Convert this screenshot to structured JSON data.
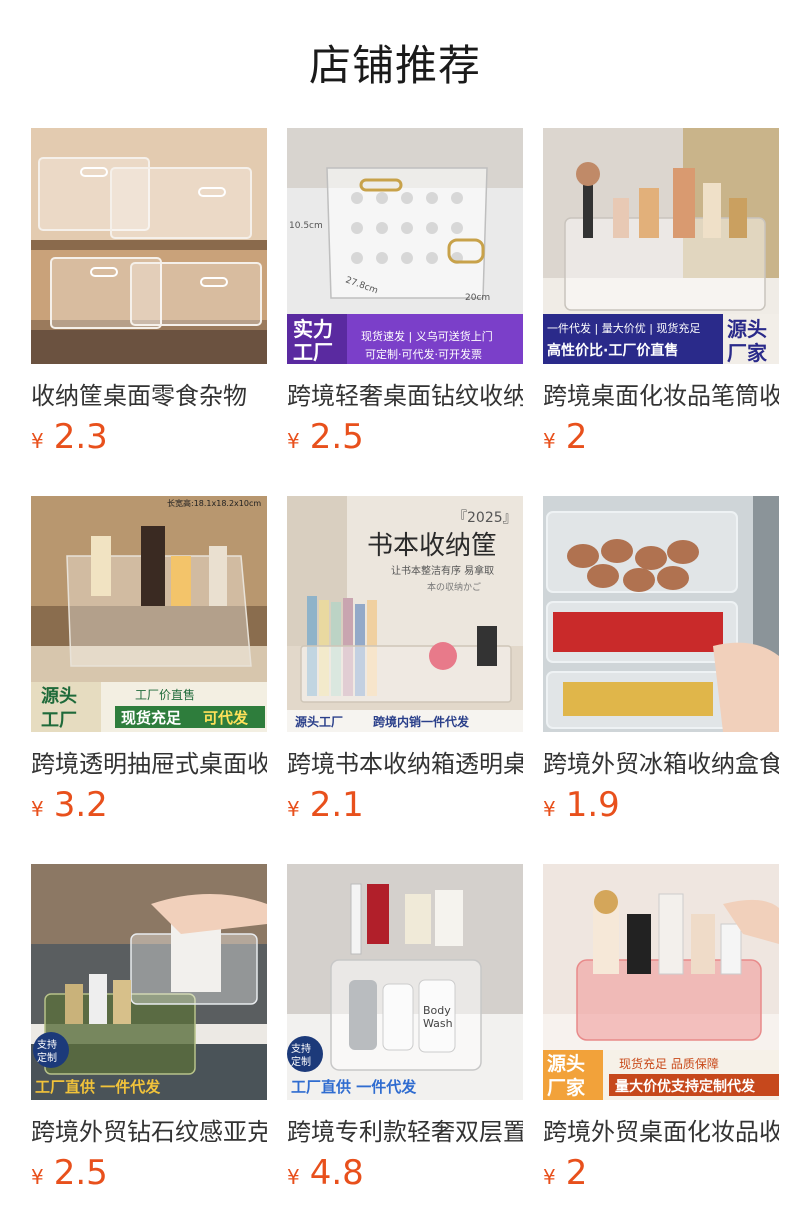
{
  "page": {
    "title": "店铺推荐"
  },
  "products": [
    {
      "name": "收纳筐桌面零食杂物",
      "currency": "¥",
      "price": "2.3",
      "image_text": []
    },
    {
      "name": "跨境轻奢桌面钻纹收纳",
      "currency": "¥",
      "price": "2.5",
      "image_text": [
        "10.5cm",
        "27.8cm",
        "20cm",
        "实力",
        "工厂",
        "现货速发 | 义乌可送货上门",
        "可定制·可代发·可开发票"
      ]
    },
    {
      "name": "跨境桌面化妆品笔筒收",
      "currency": "¥",
      "price": "2",
      "image_text": [
        "一件代发 | 量大价优 | 现货充足",
        "源头",
        "厂家",
        "高性价比·工厂价直售"
      ]
    },
    {
      "name": "跨境透明抽屉式桌面收",
      "currency": "¥",
      "price": "3.2",
      "image_text": [
        "长宽高:18.1x18.2x10cm",
        "源头",
        "工厂",
        "工厂价直售",
        "现货充足",
        "可代发"
      ]
    },
    {
      "name": "跨境书本收纳箱透明桌",
      "currency": "¥",
      "price": "2.1",
      "image_text": [
        "『2025』",
        "书本收纳筐",
        "让书本整洁有序 易拿取",
        "本の収纳かご",
        "源头工厂",
        "跨境内销一件代发"
      ]
    },
    {
      "name": "跨境外贸冰箱收纳盒食",
      "currency": "¥",
      "price": "1.9",
      "image_text": []
    },
    {
      "name": "跨境外贸钻石纹感亚克",
      "currency": "¥",
      "price": "2.5",
      "image_text": [
        "支持",
        "定制",
        "工厂直供 一件代发"
      ]
    },
    {
      "name": "跨境专利款轻奢双层置",
      "currency": "¥",
      "price": "4.8",
      "image_text": [
        "支持",
        "定制",
        "工厂直供 一件代发",
        "Body",
        "Wash"
      ]
    },
    {
      "name": "跨境外贸桌面化妆品收",
      "currency": "¥",
      "price": "2",
      "image_text": [
        "源头",
        "厂家",
        "现货充足 品质保障",
        "量大价优支持定制代发"
      ]
    }
  ],
  "colors": {
    "price": "#e8501c",
    "title": "#1a1a1a",
    "name": "#333333"
  }
}
